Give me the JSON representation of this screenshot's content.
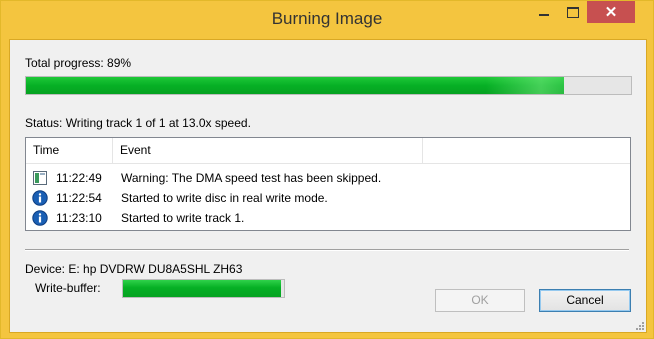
{
  "window": {
    "title": "Burning Image",
    "close_glyph": "✕"
  },
  "progress": {
    "label": "Total progress: 89%",
    "percent": 89
  },
  "status": {
    "text": "Status: Writing track 1 of 1 at 13.0x speed."
  },
  "log": {
    "columns": [
      "Time",
      "Event"
    ],
    "rows": [
      {
        "icon": "warning-icon",
        "time": "11:22:49",
        "event": "Warning: The DMA speed test has been skipped."
      },
      {
        "icon": "info-icon",
        "time": "11:22:54",
        "event": "Started to write disc in real write mode."
      },
      {
        "icon": "info-icon",
        "time": "11:23:10",
        "event": "Started to write track 1."
      }
    ]
  },
  "device": {
    "label": "Device: E: hp DVDRW  DU8A5SHL ZH63"
  },
  "write_buffer": {
    "label": "Write-buffer:",
    "percent": 98
  },
  "buttons": {
    "ok_label": "OK",
    "cancel_label": "Cancel"
  },
  "colors": {
    "titlebar": "#f4c53f",
    "progress_green": "#06b025",
    "close_button": "#c75050",
    "info_blue": "#1a5fb4"
  }
}
